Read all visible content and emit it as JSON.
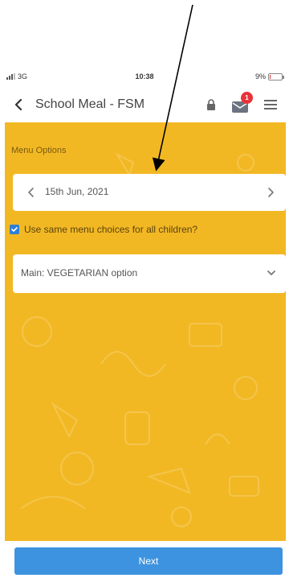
{
  "status_bar": {
    "carrier": "3G",
    "time": "10:38",
    "battery": "9%",
    "battery_level": 0.09
  },
  "header": {
    "back_icon": "chevron-left-icon",
    "title": "School Meal - FSM",
    "lock_icon": "lock-icon",
    "mail_icon": "mail-icon",
    "mail_badge_count": "1",
    "menu_icon": "hamburger-icon"
  },
  "menu_panel": {
    "section_label": "Menu Options",
    "date": {
      "label": "15th Jun, 2021",
      "prev_icon": "chevron-left-icon",
      "next_icon": "chevron-right-icon"
    },
    "same_choices": {
      "label": "Use same menu choices for all children?",
      "checked": true
    },
    "meal_select": {
      "value": "Main: VEGETARIAN option",
      "icon": "chevron-down-icon"
    }
  },
  "footer": {
    "next_label": "Next"
  },
  "colors": {
    "panel_yellow": "#f2b824",
    "accent_blue": "#3d93e0",
    "checkbox_blue": "#2f7fd6",
    "badge_red": "#e8333a",
    "annotation_arrow": "#000000"
  }
}
